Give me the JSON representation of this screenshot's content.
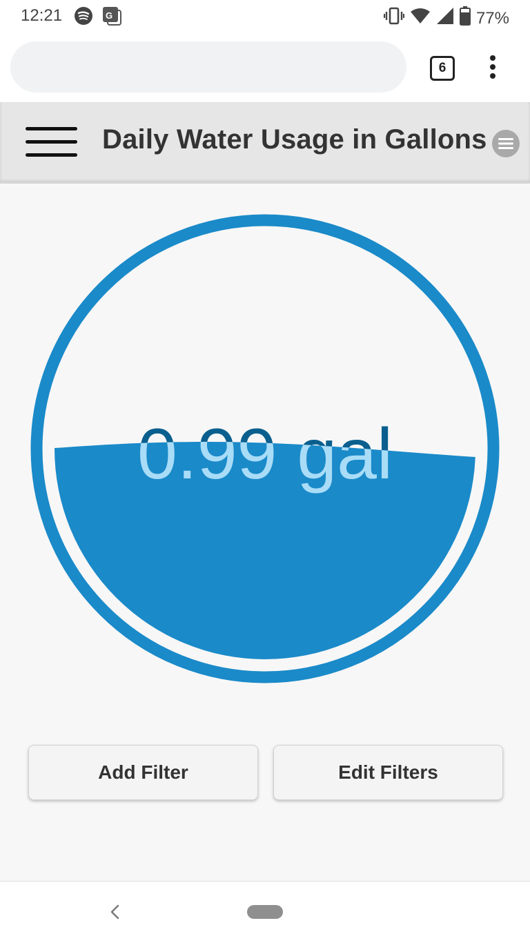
{
  "status_bar": {
    "time": "12:21",
    "battery": "77%",
    "icons": [
      "spotify-icon",
      "translate-icon",
      "vibrate-icon",
      "wifi-icon",
      "signal-icon",
      "battery-icon"
    ]
  },
  "browser": {
    "url": "",
    "tab_count": "6",
    "icons": [
      "tabs-icon",
      "overflow-menu-icon"
    ]
  },
  "header": {
    "title": "Daily Water Usage in Gallons",
    "icons": [
      "hamburger-menu-icon",
      "options-icon"
    ]
  },
  "gauge": {
    "value_label": "0.99 gal",
    "fill_level": 0.5,
    "colors": {
      "ring": "#1a8ac9",
      "water": "#1a8ac9",
      "text_above": "#0a5f8e",
      "text_in_water": "#a9dcf7"
    }
  },
  "buttons": {
    "add_filter": "Add Filter",
    "edit_filters": "Edit Filters"
  },
  "nav_bar": {
    "icons": [
      "back-icon",
      "home-pill-icon"
    ]
  },
  "colors": {
    "accent": "#1a8ac9",
    "header_bg": "#e6e6e6",
    "page_bg": "#f7f7f7"
  }
}
